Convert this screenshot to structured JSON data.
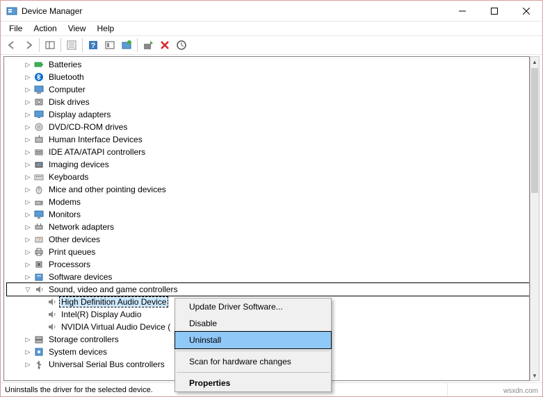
{
  "window": {
    "title": "Device Manager"
  },
  "menu": {
    "file": "File",
    "action": "Action",
    "view": "View",
    "help": "Help"
  },
  "toolbar": {
    "back": "←",
    "forward": "→",
    "show_hide": "▭",
    "help": "?",
    "scan": "⟳",
    "uninstall": "✕"
  },
  "tree": {
    "nodes": [
      {
        "depth": 1,
        "expander": "▷",
        "icon": "battery-icon",
        "label": "Batteries"
      },
      {
        "depth": 1,
        "expander": "▷",
        "icon": "bluetooth-icon",
        "label": "Bluetooth"
      },
      {
        "depth": 1,
        "expander": "▷",
        "icon": "computer-icon",
        "label": "Computer"
      },
      {
        "depth": 1,
        "expander": "▷",
        "icon": "disk-icon",
        "label": "Disk drives"
      },
      {
        "depth": 1,
        "expander": "▷",
        "icon": "display-icon",
        "label": "Display adapters"
      },
      {
        "depth": 1,
        "expander": "▷",
        "icon": "dvd-icon",
        "label": "DVD/CD-ROM drives"
      },
      {
        "depth": 1,
        "expander": "▷",
        "icon": "hid-icon",
        "label": "Human Interface Devices"
      },
      {
        "depth": 1,
        "expander": "▷",
        "icon": "ide-icon",
        "label": "IDE ATA/ATAPI controllers"
      },
      {
        "depth": 1,
        "expander": "▷",
        "icon": "imaging-icon",
        "label": "Imaging devices"
      },
      {
        "depth": 1,
        "expander": "▷",
        "icon": "keyboard-icon",
        "label": "Keyboards"
      },
      {
        "depth": 1,
        "expander": "▷",
        "icon": "mouse-icon",
        "label": "Mice and other pointing devices"
      },
      {
        "depth": 1,
        "expander": "▷",
        "icon": "modem-icon",
        "label": "Modems"
      },
      {
        "depth": 1,
        "expander": "▷",
        "icon": "monitor-icon",
        "label": "Monitors"
      },
      {
        "depth": 1,
        "expander": "▷",
        "icon": "network-icon",
        "label": "Network adapters"
      },
      {
        "depth": 1,
        "expander": "▷",
        "icon": "other-icon",
        "label": "Other devices"
      },
      {
        "depth": 1,
        "expander": "▷",
        "icon": "printer-icon",
        "label": "Print queues"
      },
      {
        "depth": 1,
        "expander": "▷",
        "icon": "cpu-icon",
        "label": "Processors"
      },
      {
        "depth": 1,
        "expander": "▷",
        "icon": "software-icon",
        "label": "Software devices"
      },
      {
        "depth": 1,
        "expander": "▽",
        "icon": "sound-icon",
        "label": "Sound, video and game controllers",
        "highlighted": true
      },
      {
        "depth": 2,
        "expander": "",
        "icon": "speaker-icon",
        "label": "High Definition Audio Device",
        "selected": true
      },
      {
        "depth": 2,
        "expander": "",
        "icon": "speaker-icon",
        "label": "Intel(R) Display Audio"
      },
      {
        "depth": 2,
        "expander": "",
        "icon": "speaker-icon",
        "label": "NVIDIA Virtual Audio Device ("
      },
      {
        "depth": 1,
        "expander": "▷",
        "icon": "storage-icon",
        "label": "Storage controllers"
      },
      {
        "depth": 1,
        "expander": "▷",
        "icon": "system-icon",
        "label": "System devices"
      },
      {
        "depth": 1,
        "expander": "▷",
        "icon": "usb-icon",
        "label": "Universal Serial Bus controllers"
      }
    ]
  },
  "context_menu": {
    "items": [
      {
        "label": "Update Driver Software..."
      },
      {
        "label": "Disable"
      },
      {
        "label": "Uninstall",
        "hover": true
      },
      {
        "sep": true
      },
      {
        "label": "Scan for hardware changes"
      },
      {
        "sep": true
      },
      {
        "label": "Properties",
        "bold": true
      }
    ]
  },
  "status": {
    "text": "Uninstalls the driver for the selected device."
  },
  "watermark": "wsxdn.com"
}
